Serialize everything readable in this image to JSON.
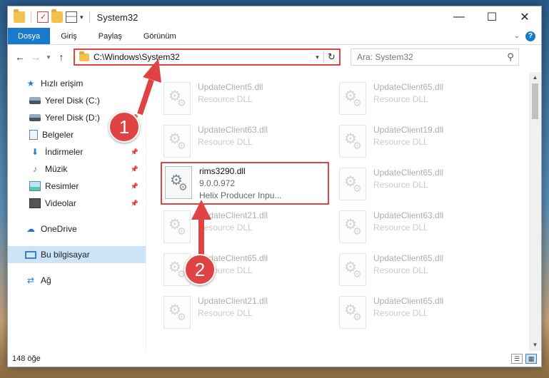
{
  "window": {
    "title": "System32"
  },
  "caption": {
    "minimize": "—",
    "maximize": "☐",
    "close": "✕"
  },
  "ribbon": {
    "tabs": [
      "Dosya",
      "Giriş",
      "Paylaş",
      "Görünüm"
    ],
    "help": "?"
  },
  "nav": {
    "back": "←",
    "forward": "→",
    "recent": "▾",
    "up": "↑",
    "address": "C:\\Windows\\System32",
    "search_placeholder": "Ara: System32"
  },
  "sidebar": {
    "quick_access": "Hızlı erişim",
    "items": [
      {
        "label": "Yerel Disk (C:)",
        "icon": "drive-icon"
      },
      {
        "label": "Yerel Disk (D:)",
        "icon": "drive-icon"
      },
      {
        "label": "Belgeler",
        "icon": "documents-icon"
      },
      {
        "label": "İndirmeler",
        "icon": "downloads-icon"
      },
      {
        "label": "Müzik",
        "icon": "music-icon"
      },
      {
        "label": "Resimler",
        "icon": "pictures-icon"
      },
      {
        "label": "Videolar",
        "icon": "videos-icon"
      }
    ],
    "onedrive": "OneDrive",
    "this_pc": "Bu bilgisayar",
    "network": "Ağ"
  },
  "files": [
    {
      "name": "UpdateClient5.dll",
      "sub1": "Resource DLL",
      "sub2": ""
    },
    {
      "name": "UpdateClient65.dll",
      "sub1": "Resource DLL",
      "sub2": ""
    },
    {
      "name": "UpdateClient63.dll",
      "sub1": "Resource DLL",
      "sub2": ""
    },
    {
      "name": "UpdateClient19.dll",
      "sub1": "Resource DLL",
      "sub2": ""
    },
    {
      "name": "rims3290.dll",
      "sub1": "9.0.0.972",
      "sub2": "Helix Producer Inpu...",
      "highlight": true
    },
    {
      "name": "UpdateClient65.dll",
      "sub1": "Resource DLL",
      "sub2": ""
    },
    {
      "name": "UpdateClient21.dll",
      "sub1": "Resource DLL",
      "sub2": ""
    },
    {
      "name": "UpdateClient63.dll",
      "sub1": "Resource DLL",
      "sub2": ""
    },
    {
      "name": "UpdateClient65.dll",
      "sub1": "Resource DLL",
      "sub2": ""
    },
    {
      "name": "UpdateClient65.dll",
      "sub1": "Resource DLL",
      "sub2": ""
    },
    {
      "name": "UpdateClient21.dll",
      "sub1": "Resource DLL",
      "sub2": ""
    },
    {
      "name": "UpdateClient65.dll",
      "sub1": "Resource DLL",
      "sub2": ""
    }
  ],
  "status": {
    "count": "148 öğe"
  },
  "annotations": {
    "step1": "1",
    "step2": "2",
    "color": "#e04343"
  }
}
